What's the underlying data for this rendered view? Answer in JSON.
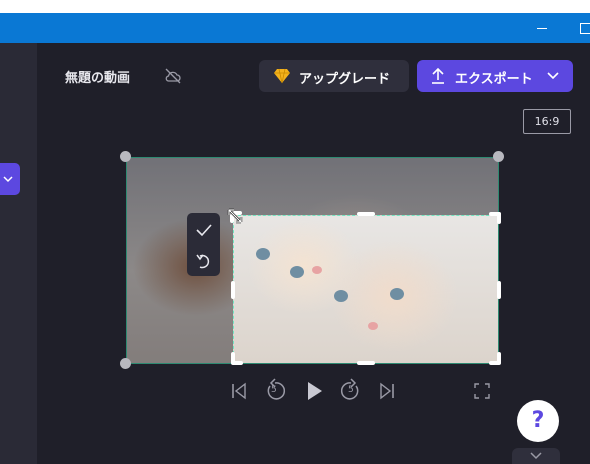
{
  "window": {
    "minimize_glyph": "—",
    "maximize_glyph": "□"
  },
  "header": {
    "project_title": "無題の動画",
    "upgrade_label": "アップグレード",
    "export_label": "エクスポート"
  },
  "canvas": {
    "aspect_ratio": "16:9"
  },
  "colors": {
    "titlebar": "#0a78d4",
    "background": "#1f1f29",
    "accent": "#5c48e0",
    "crop_border": "#6fe6c2",
    "gem": "#f3b21d"
  },
  "icons": {
    "cloud": "cloud-off-icon",
    "upgrade": "gem-icon",
    "export": "upload-icon",
    "confirm": "check-icon",
    "reset": "undo-icon",
    "skip_back": "skip-back-icon",
    "rewind": "rewind-5-icon",
    "play": "play-icon",
    "forward": "forward-5-icon",
    "skip_forward": "skip-forward-icon",
    "fullscreen": "fullscreen-icon",
    "help": "help-icon"
  },
  "playback": {
    "rewind_seconds": "5",
    "forward_seconds": "5"
  },
  "help": {
    "glyph": "?"
  }
}
